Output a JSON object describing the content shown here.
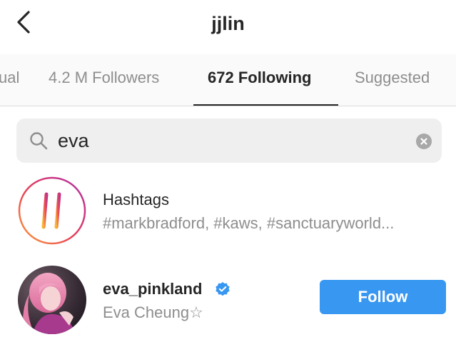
{
  "header": {
    "title": "jjlin",
    "back_icon": "chevron-left-icon"
  },
  "tabs": [
    {
      "label": "Mutual",
      "visible_label": "ual",
      "active": false
    },
    {
      "label": "4.2 M Followers",
      "active": false
    },
    {
      "label": "672 Following",
      "active": true
    },
    {
      "label": "Suggested",
      "active": false
    }
  ],
  "search": {
    "value": "eva",
    "search_icon": "search-icon",
    "clear_icon": "clear-icon"
  },
  "results": {
    "hashtags": {
      "title": "Hashtags",
      "subtitle": "#markbradford, #kaws, #sanctuaryworld...",
      "icon": "hashtag-icon"
    },
    "user": {
      "username": "eva_pinkland",
      "full_name": "Eva Cheung☆",
      "verified": true,
      "follow_label": "Follow"
    }
  },
  "colors": {
    "accent": "#3897f0",
    "text_primary": "#262626",
    "text_secondary": "#8e8e8e",
    "tab_bg": "#fafafa",
    "search_bg": "#efefef"
  }
}
